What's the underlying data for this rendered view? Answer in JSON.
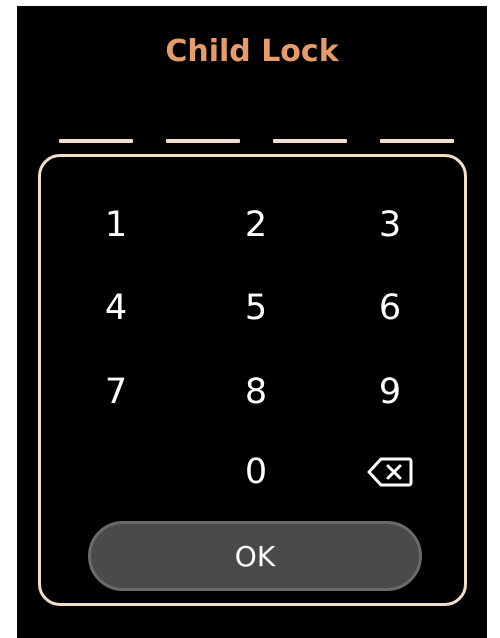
{
  "title": "Child Lock",
  "colors": {
    "accent": "#e89b6a",
    "panel_border": "#f3dfc9",
    "pin_slot": "#f3dfc9",
    "button_fill": "#4a4a4c",
    "background": "#000000"
  },
  "pin": {
    "length": 4,
    "entered": ""
  },
  "keypad": {
    "keys": [
      {
        "label": "1",
        "role": "digit"
      },
      {
        "label": "2",
        "role": "digit"
      },
      {
        "label": "3",
        "role": "digit"
      },
      {
        "label": "4",
        "role": "digit"
      },
      {
        "label": "5",
        "role": "digit"
      },
      {
        "label": "6",
        "role": "digit"
      },
      {
        "label": "7",
        "role": "digit"
      },
      {
        "label": "8",
        "role": "digit"
      },
      {
        "label": "9",
        "role": "digit"
      },
      {
        "label": "",
        "role": "blank"
      },
      {
        "label": "0",
        "role": "digit"
      },
      {
        "label": "",
        "role": "backspace",
        "icon": "backspace-icon"
      }
    ],
    "ok_label": "OK"
  }
}
